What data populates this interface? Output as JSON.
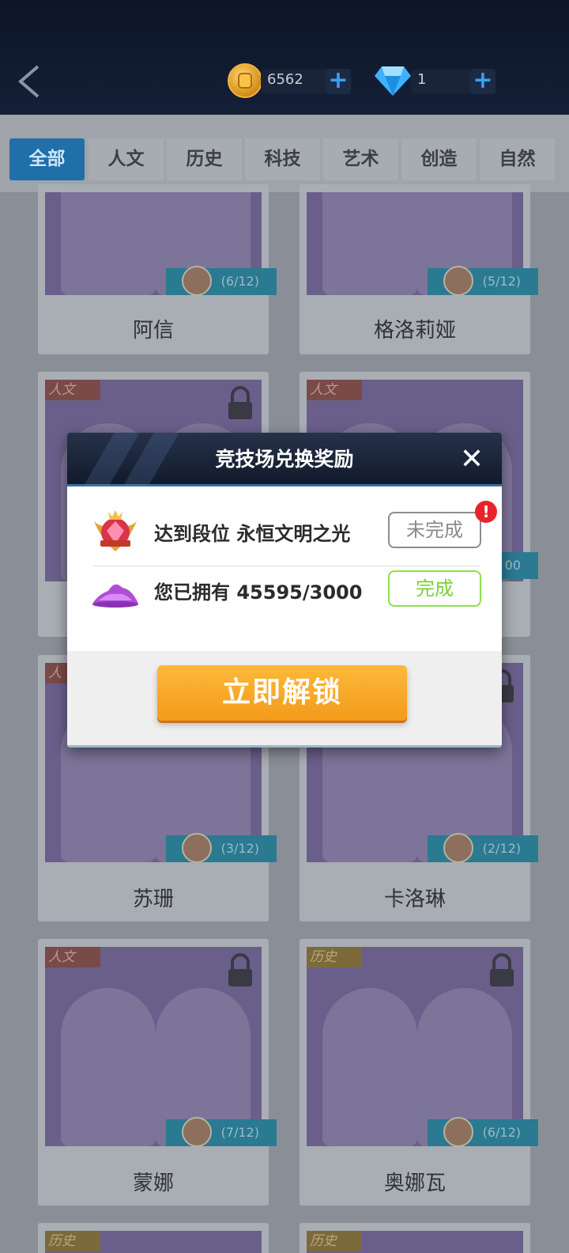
{
  "header": {
    "coins": "6562",
    "gems": "1"
  },
  "tabs": [
    {
      "label": "全部",
      "active": true
    },
    {
      "label": "人文",
      "active": false
    },
    {
      "label": "历史",
      "active": false
    },
    {
      "label": "科技",
      "active": false
    },
    {
      "label": "艺术",
      "active": false
    },
    {
      "label": "创造",
      "active": false
    },
    {
      "label": "自然",
      "active": false
    }
  ],
  "cards": [
    {
      "name": "阿信",
      "progress": "(6/12)"
    },
    {
      "name": "格洛莉娅",
      "progress": "(5/12)"
    },
    {
      "tag": "人文"
    },
    {
      "tag": "人文",
      "progress": "00"
    },
    {
      "name": "苏珊",
      "tag": "人",
      "progress": "(3/12)"
    },
    {
      "name": "卡洛琳",
      "progress": "(2/12)"
    },
    {
      "name": "蒙娜",
      "tag": "人文",
      "progress": "(7/12)"
    },
    {
      "name": "奥娜瓦",
      "tag": "历史",
      "progress": "(6/12)"
    },
    {
      "tag": "历史"
    },
    {
      "tag": "历史"
    }
  ],
  "dialog": {
    "title": "竞技场兑换奖励",
    "rows": [
      {
        "text": "达到段位 永恒文明之光",
        "status": "未完成",
        "icon": "rank-badge-icon"
      },
      {
        "text": "您已拥有 45595/3000",
        "status": "完成",
        "icon": "powder-pile-icon"
      }
    ],
    "alert_glyph": "!",
    "unlock_label": "立即解锁",
    "close_glyph": "✕"
  },
  "colors": {
    "accent_tab": "#1f6fa8",
    "unlock_button": "#f7a325",
    "done_green": "#7ccf3a",
    "alert_red": "#e8242a"
  }
}
